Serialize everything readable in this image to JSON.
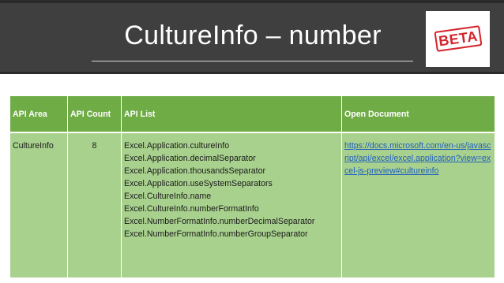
{
  "slide": {
    "title": "CultureInfo – number",
    "badge_text": "BETA",
    "colors": {
      "header_bg": "#3f3f3f",
      "table_header": "#6fac46",
      "table_body": "#a9d18e",
      "badge": "#d4242a",
      "link": "#1f5fbf"
    }
  },
  "table": {
    "headers": [
      "API Area",
      "API Count",
      "API List",
      "Open Document"
    ],
    "rows": [
      {
        "area": "CultureInfo",
        "count": "8",
        "apis": [
          "Excel.Application.cultureInfo",
          "Excel.Application.decimalSeparator",
          "Excel.Application.thousandsSeparator",
          "Excel.Application.useSystemSeparators",
          "Excel.CultureInfo.name",
          "Excel.CultureInfo.numberFormatInfo",
          "Excel.NumberFormatInfo.numberDecimalSeparator",
          "Excel.NumberFormatInfo.numberGroupSeparator"
        ],
        "doc_link": "https://docs.microsoft.com/en-us/javascript/api/excel/excel.application?view=excel-js-preview#cultureinfo"
      }
    ]
  }
}
